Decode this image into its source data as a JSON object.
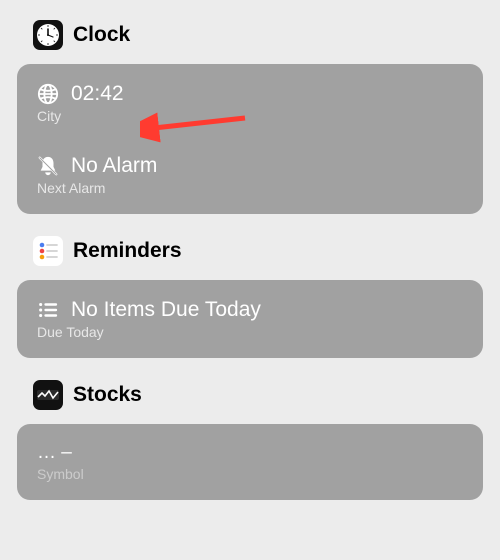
{
  "clock": {
    "title": "Clock",
    "time": "02:42",
    "city_label": "City",
    "alarm_value": "No Alarm",
    "alarm_label": "Next Alarm"
  },
  "reminders": {
    "title": "Reminders",
    "value": "No Items Due Today",
    "label": "Due Today"
  },
  "stocks": {
    "title": "Stocks",
    "value": "… –",
    "label": "Symbol"
  },
  "annotation": {
    "arrow_color": "#ff3b30"
  }
}
